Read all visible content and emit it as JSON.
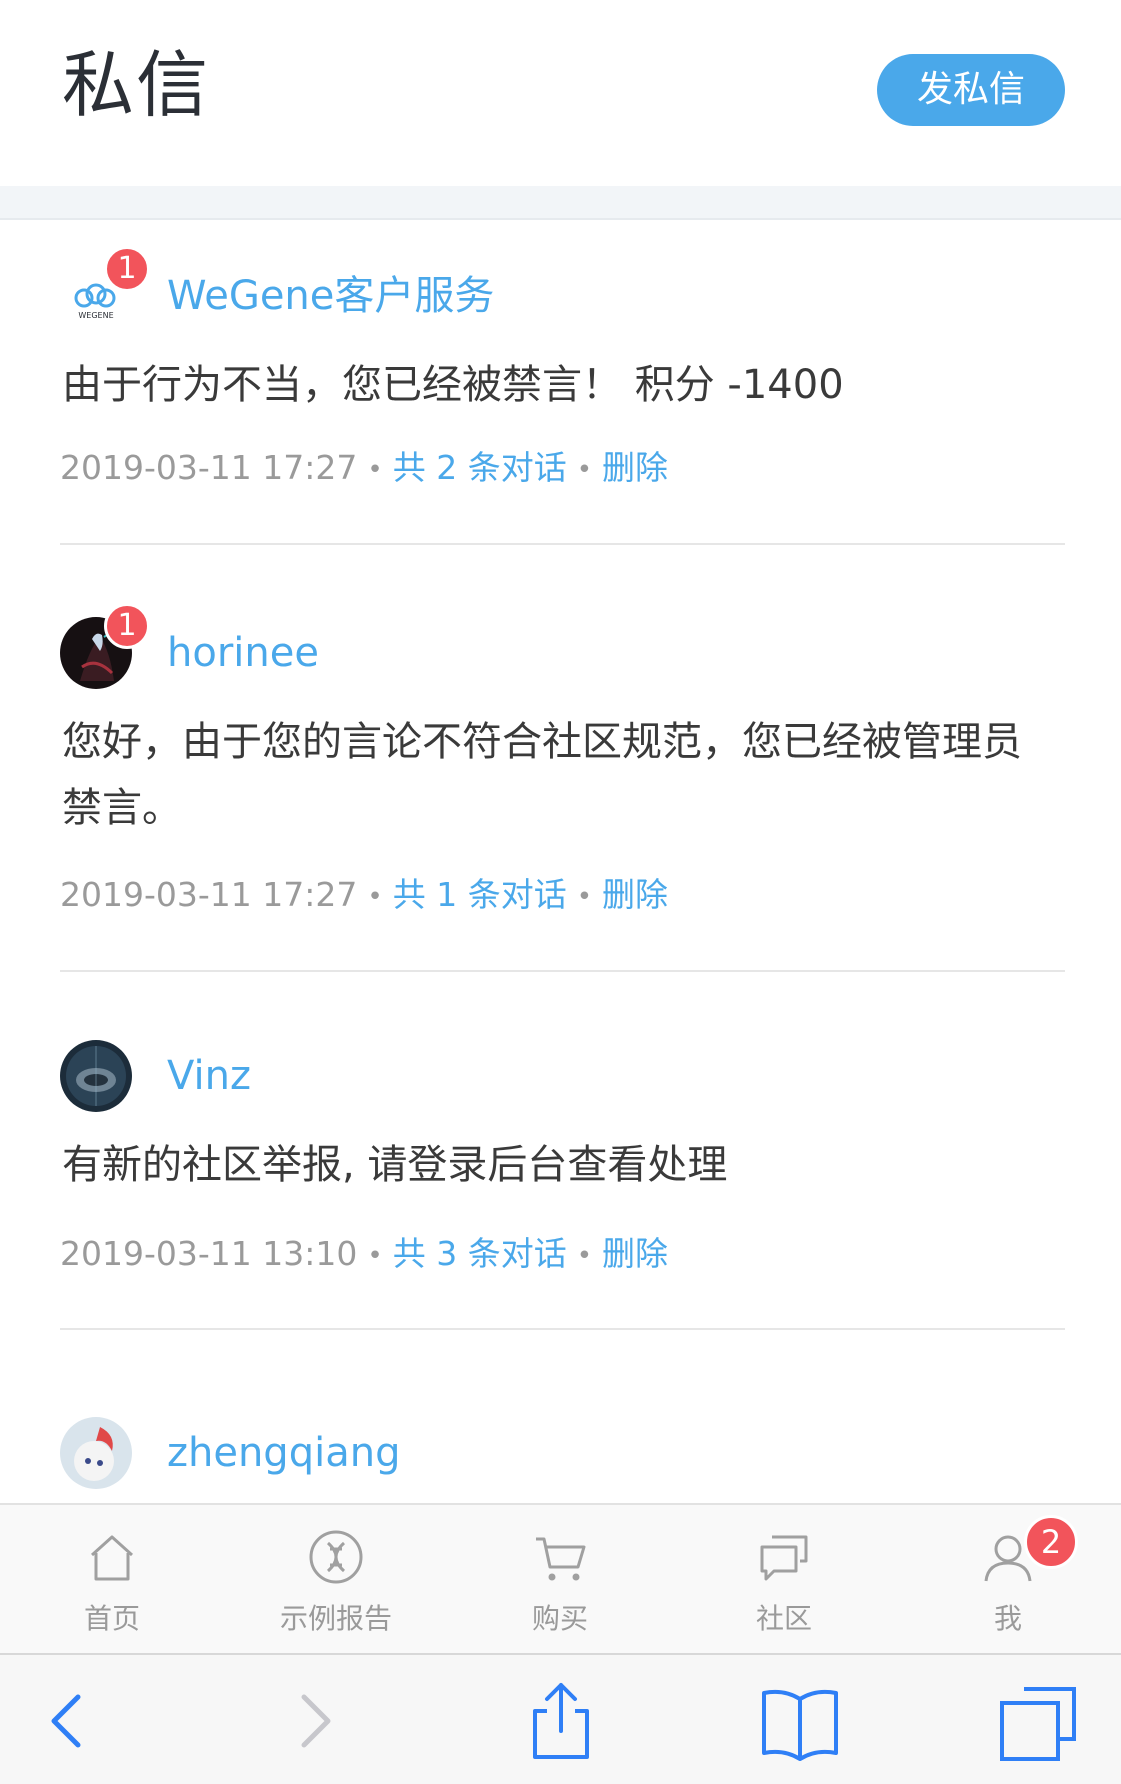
{
  "header": {
    "title": "私信",
    "compose_label": "发私信"
  },
  "messages": [
    {
      "sender": "WeGene客户服务",
      "badge": "1",
      "avatar": "wegene-logo",
      "avatar_text": "WEGENE",
      "body": "由于行为不当，您已经被禁言！ 积分 -1400",
      "time": "2019-03-11 17:27",
      "count_label": "共 2 条对话",
      "delete_label": "删除"
    },
    {
      "sender": "horinee",
      "badge": "1",
      "avatar": "dark-figure-avatar",
      "body": "您好，由于您的言论不符合社区规范，您已经被管理员禁言。",
      "time": "2019-03-11 17:27",
      "count_label": "共 1 条对话",
      "delete_label": "删除"
    },
    {
      "sender": "Vinz",
      "badge": "",
      "avatar": "dark-emblem-avatar",
      "body": "有新的社区举报, 请登录后台查看处理",
      "time": "2019-03-11 13:10",
      "count_label": "共 3 条对话",
      "delete_label": "删除"
    },
    {
      "sender": "zhengqiang",
      "badge": "",
      "avatar": "cartoon-avatar"
    }
  ],
  "meta_separator": "•",
  "tabbar": {
    "items": [
      {
        "label": "首页",
        "icon": "home-icon"
      },
      {
        "label": "示例报告",
        "icon": "dna-icon"
      },
      {
        "label": "购买",
        "icon": "cart-icon"
      },
      {
        "label": "社区",
        "icon": "chat-bubbles-icon"
      },
      {
        "label": "我",
        "icon": "user-icon",
        "badge": "2"
      }
    ]
  },
  "browser_toolbar": {
    "icons": [
      "back-icon",
      "forward-icon",
      "share-icon",
      "bookmarks-icon",
      "tabs-icon"
    ]
  },
  "colors": {
    "accent": "#4aa8ea",
    "badge": "#f2545b",
    "title": "#2b2f36",
    "muted": "#9a9a9a",
    "ios_blue": "#2f7ff6"
  }
}
